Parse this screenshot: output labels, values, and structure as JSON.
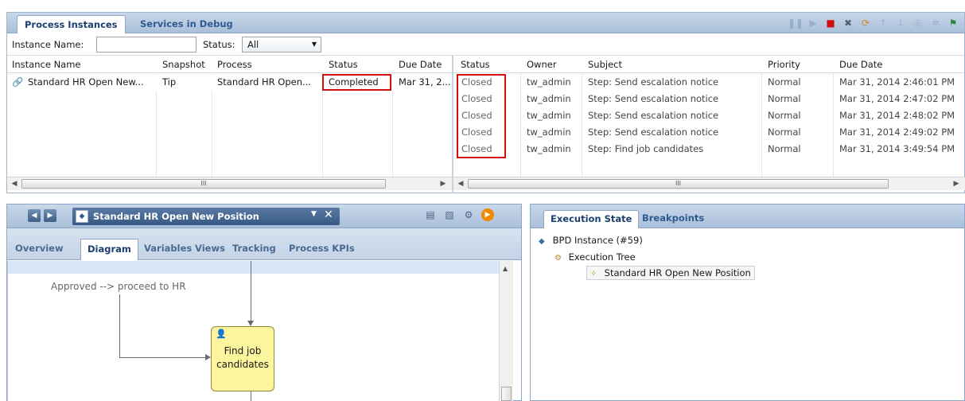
{
  "top_panel": {
    "tabs": [
      "Process Instances",
      "Services in Debug"
    ],
    "toolbar_icons": [
      "pause-icon",
      "step-icon",
      "stop-icon",
      "delete-icon",
      "refresh-icon",
      "up-icon",
      "down-icon",
      "play-icon",
      "settings-icon",
      "export-icon"
    ],
    "filter": {
      "instance_name_label": "Instance Name:",
      "instance_name_value": "",
      "status_label": "Status:",
      "status_value": "All"
    },
    "left_table": {
      "columns": [
        "Instance Name",
        "Snapshot",
        "Process",
        "Status",
        "Due Date"
      ],
      "rows": [
        {
          "instance_name": "Standard HR Open New...",
          "snapshot": "Tip",
          "process": "Standard HR Open...",
          "status": "Completed",
          "due_date": "Mar 31, 2..."
        }
      ]
    },
    "right_table": {
      "columns": [
        "Status",
        "Owner",
        "Subject",
        "Priority",
        "Due Date"
      ],
      "rows": [
        {
          "status": "Closed",
          "owner": "tw_admin",
          "subject": "Step: Send escalation notice",
          "priority": "Normal",
          "due_date": "Mar 31, 2014 2:46:01 PM"
        },
        {
          "status": "Closed",
          "owner": "tw_admin",
          "subject": "Step: Send escalation notice",
          "priority": "Normal",
          "due_date": "Mar 31, 2014 2:47:02 PM"
        },
        {
          "status": "Closed",
          "owner": "tw_admin",
          "subject": "Step: Send escalation notice",
          "priority": "Normal",
          "due_date": "Mar 31, 2014 2:48:02 PM"
        },
        {
          "status": "Closed",
          "owner": "tw_admin",
          "subject": "Step: Send escalation notice",
          "priority": "Normal",
          "due_date": "Mar 31, 2014 2:49:02 PM"
        },
        {
          "status": "Closed",
          "owner": "tw_admin",
          "subject": "Step: Find job candidates",
          "priority": "Normal",
          "due_date": "Mar 31, 2014 3:49:54 PM"
        }
      ]
    },
    "scroll_thumb_label": "III",
    "highlight_color": "#d01010"
  },
  "diagram_panel": {
    "process_title": "Standard HR Open New Position",
    "tabs": [
      "Overview",
      "Diagram",
      "Variables",
      "Views",
      "Tracking",
      "Process KPIs"
    ],
    "active_tab": "Diagram",
    "flow_label": "Approved --> proceed to HR",
    "task_line1": "Find job",
    "task_line2": "candidates"
  },
  "execution_panel": {
    "tabs": [
      "Execution State",
      "Breakpoints"
    ],
    "tree": {
      "root": "BPD Instance (#59)",
      "child": "Execution Tree",
      "leaf": "Standard HR Open New Position"
    }
  }
}
